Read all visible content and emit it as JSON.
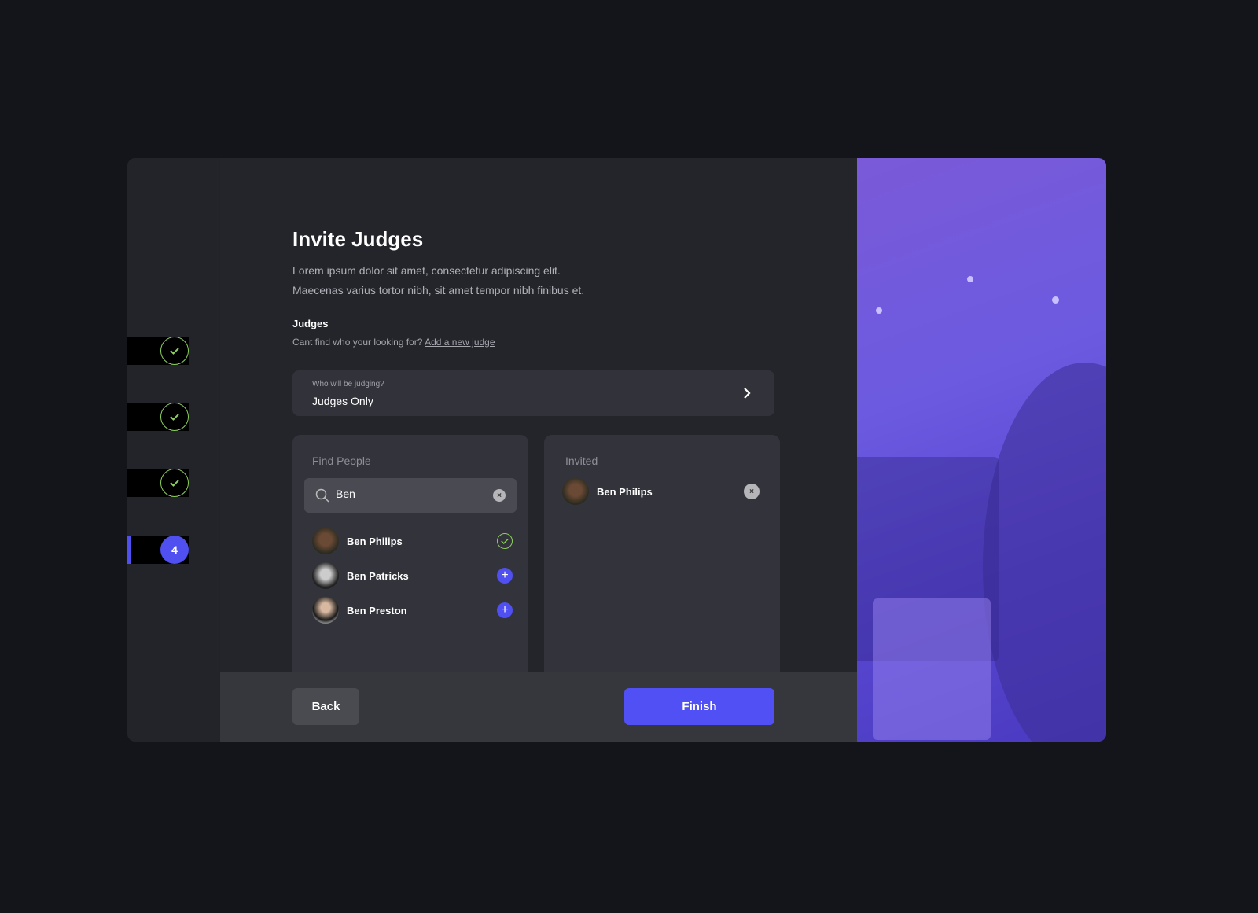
{
  "steps": [
    {
      "state": "done",
      "icon": "check-icon"
    },
    {
      "state": "done",
      "icon": "check-icon"
    },
    {
      "state": "done",
      "icon": "check-icon"
    },
    {
      "state": "active",
      "number": "4"
    }
  ],
  "title": "Invite Judges",
  "description": [
    "Lorem ipsum dolor sit amet, consectetur adipiscing elit.",
    "Maecenas varius tortor nibh, sit amet tempor nibh finibus et."
  ],
  "judges_label": "Judges",
  "hint_text": "Cant find who your looking for?",
  "hint_link": "Add a new judge",
  "judging_select": {
    "label": "Who will be judging?",
    "value": "Judges Only"
  },
  "find_people": {
    "title": "Find People",
    "search_value": "Ben",
    "results": [
      {
        "name": "Ben Philips",
        "status": "added"
      },
      {
        "name": "Ben Patricks",
        "status": "add"
      },
      {
        "name": "Ben Preston",
        "status": "add"
      }
    ]
  },
  "invited": {
    "title": "Invited",
    "people": [
      {
        "name": "Ben Philips"
      }
    ]
  },
  "footer": {
    "back": "Back",
    "finish": "Finish"
  },
  "colors": {
    "accent": "#5050f5",
    "success": "#8ccf5e",
    "background": "#14151a"
  }
}
